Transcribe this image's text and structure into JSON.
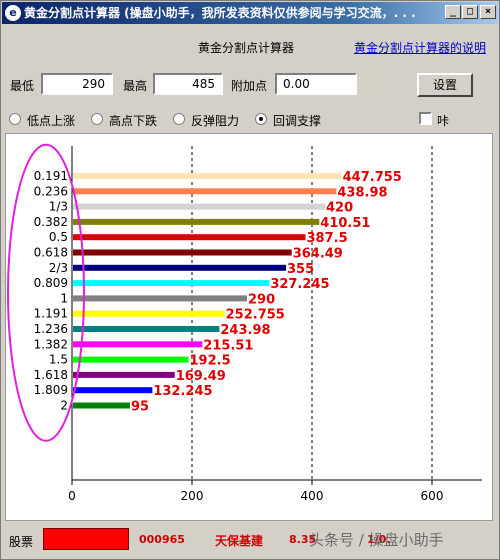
{
  "window": {
    "title": "黄金分割点计算器 (操盘小助手，我所发表资料仅供参阅与学习交流，. . .",
    "icon": "e-circle-icon",
    "minimize_glyph": "_",
    "maximize_glyph": "□",
    "close_glyph": "×"
  },
  "header": {
    "app_title": "黄金分割点计算器",
    "help_link": "黄金分割点计算器的说明"
  },
  "inputs": {
    "low_label": "最低",
    "low_value": "290",
    "high_label": "最高",
    "high_value": "485",
    "add_label": "附加点",
    "add_value": "0.00",
    "settings_button": "设置"
  },
  "modes": {
    "options": [
      "低点上涨",
      "高点下跌",
      "反弹阻力",
      "回调支撑"
    ],
    "selected": "回调支撑",
    "checkbox_label": "咔",
    "checkbox_checked": false
  },
  "chart_data": {
    "type": "bar",
    "orientation": "horizontal",
    "categories": [
      "0.191",
      "0.236",
      "1/3",
      "0.382",
      "0.5",
      "0.618",
      "2/3",
      "0.809",
      "1",
      "1.191",
      "1.236",
      "1.382",
      "1.5",
      "1.618",
      "1.809",
      "2"
    ],
    "values": [
      447.755,
      438.98,
      420,
      410.51,
      387.5,
      364.49,
      355,
      327.245,
      290,
      252.755,
      243.98,
      215.51,
      192.5,
      169.49,
      132.245,
      95
    ],
    "value_labels": [
      "447.755",
      "438.98",
      "420",
      "410.51",
      "387.5",
      "364.49",
      "355",
      "327.245",
      "290",
      "252.755",
      "243.98",
      "215.51",
      "192.5",
      "169.49",
      "132.245",
      "95"
    ],
    "colors": [
      "#ffe4b5",
      "#ff7f50",
      "#d3d3d3",
      "#808000",
      "#dc0000",
      "#800000",
      "#000080",
      "#00ffff",
      "#808080",
      "#ffff00",
      "#008080",
      "#ff00ff",
      "#00ff00",
      "#800080",
      "#0000ff",
      "#008000"
    ],
    "label_color": "#e00000",
    "xlim": [
      0,
      680
    ],
    "xticks": [
      0,
      200,
      400,
      600
    ],
    "xtick_labels": [
      "0",
      "200",
      "400",
      "600"
    ],
    "grid": "vertical dashed",
    "annotation": "magenta ellipse around ratio labels"
  },
  "stock": {
    "label": "股票",
    "swatch_color": "#ff0000",
    "code": "000965",
    "name": "天保基建",
    "price": "8.35",
    "change": "1/0.",
    "watermark": "头条号 / 操盘小助手"
  }
}
